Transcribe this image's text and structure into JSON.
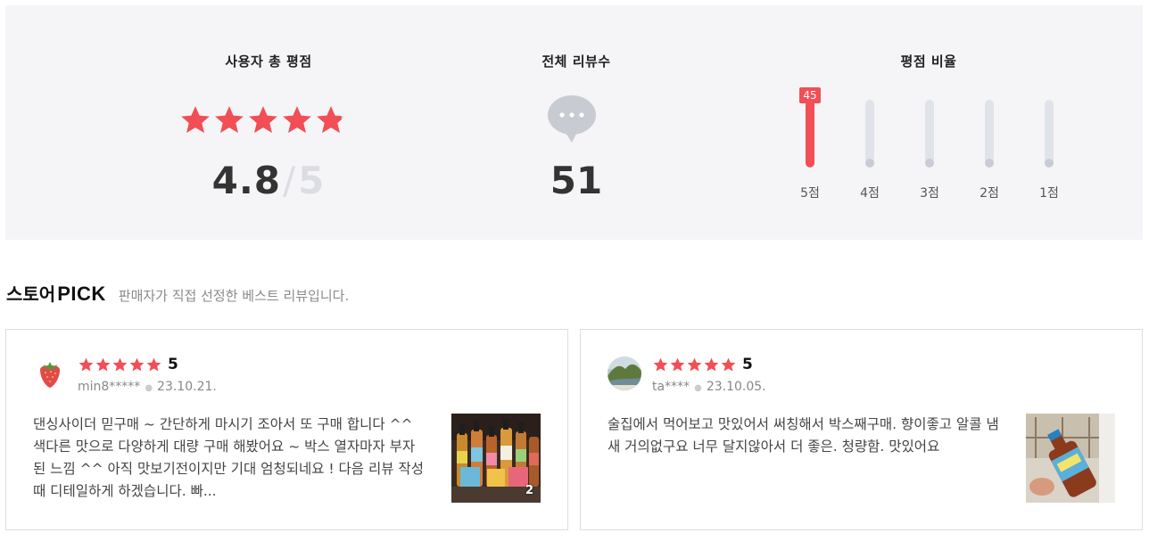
{
  "summary": {
    "rating": {
      "title": "사용자 총 평점",
      "score": "4.8",
      "slash": "/",
      "max": "5",
      "stars": 4.8
    },
    "review_count": {
      "title": "전체 리뷰수",
      "count": "51",
      "icon": "speech-bubble-icon"
    },
    "ratio": {
      "title": "평점 비율",
      "bars": [
        {
          "label": "5점",
          "count": "45",
          "fraction": 1.0
        },
        {
          "label": "4점",
          "count": "",
          "fraction": 0.06
        },
        {
          "label": "3점",
          "count": "",
          "fraction": 0.06
        },
        {
          "label": "2점",
          "count": "",
          "fraction": 0
        },
        {
          "label": "1점",
          "count": "",
          "fraction": 0
        }
      ]
    }
  },
  "pick": {
    "title_ko": "스토어",
    "title_en": "PICK",
    "description": "판매자가 직접 선정한 베스트 리뷰입니다."
  },
  "reviews": [
    {
      "score": "5",
      "user": "min8*****",
      "date": "23.10.21.",
      "text": "댄싱사이더 믿구매 ~ 간단하게 마시기 조아서 또 구매 합니다 ^^ 색다른 맛으로 다양하게 대량 구매 해봤어요 ~ 박스 열자마자 부자된 느낌 ^^ 아직 맛보기전이지만 기대 엄청되네요 ! 다음 리뷰 작성때 디테일하게 하겠습니다. 빠...",
      "image_count": "2",
      "avatar_icon": "strawberry-icon"
    },
    {
      "score": "5",
      "user": "ta****",
      "date": "23.10.05.",
      "text": "술집에서 먹어보고 맛있어서 써칭해서 박스째구매. 향이좋고 알콜 냄새 거의없구요 너무 달지않아서 더 좋은. 청량함. 맛있어요",
      "image_count": "",
      "avatar_icon": "landscape-avatar-icon"
    }
  ],
  "colors": {
    "accent": "#f24e55",
    "track": "#e1e3ea",
    "panel": "#f5f5f7"
  }
}
